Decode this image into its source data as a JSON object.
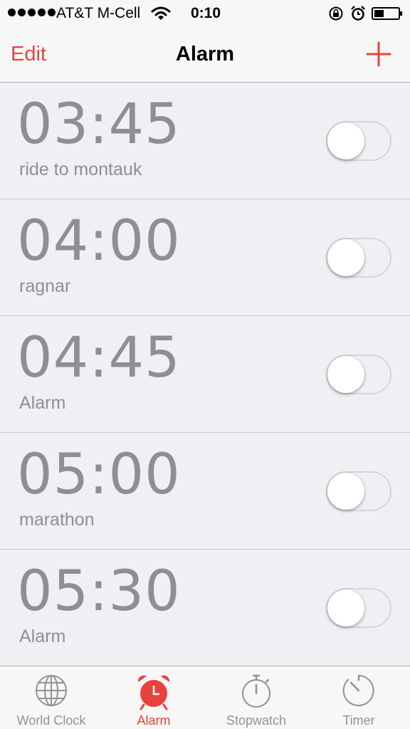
{
  "status_bar": {
    "carrier": "AT&T M-Cell",
    "time": "0:10",
    "icons": [
      "signal-dots-icon",
      "wifi-icon",
      "rotation-lock-icon",
      "alarm-icon",
      "battery-icon"
    ]
  },
  "nav": {
    "edit_label": "Edit",
    "title": "Alarm",
    "add_icon": "plus-icon"
  },
  "alarms": [
    {
      "time": "03:45",
      "label": "ride to montauk",
      "enabled": false
    },
    {
      "time": "04:00",
      "label": "ragnar",
      "enabled": false
    },
    {
      "time": "04:45",
      "label": "Alarm",
      "enabled": false
    },
    {
      "time": "05:00",
      "label": "marathon",
      "enabled": false
    },
    {
      "time": "05:30",
      "label": "Alarm",
      "enabled": false
    }
  ],
  "tabs": [
    {
      "label": "World Clock",
      "icon": "globe-icon",
      "active": false
    },
    {
      "label": "Alarm",
      "icon": "alarm-clock-icon",
      "active": true
    },
    {
      "label": "Stopwatch",
      "icon": "stopwatch-icon",
      "active": false
    },
    {
      "label": "Timer",
      "icon": "timer-icon",
      "active": false
    }
  ],
  "colors": {
    "accent": "#e8433a",
    "background": "#efeff4",
    "text_secondary": "#8e8e93"
  }
}
